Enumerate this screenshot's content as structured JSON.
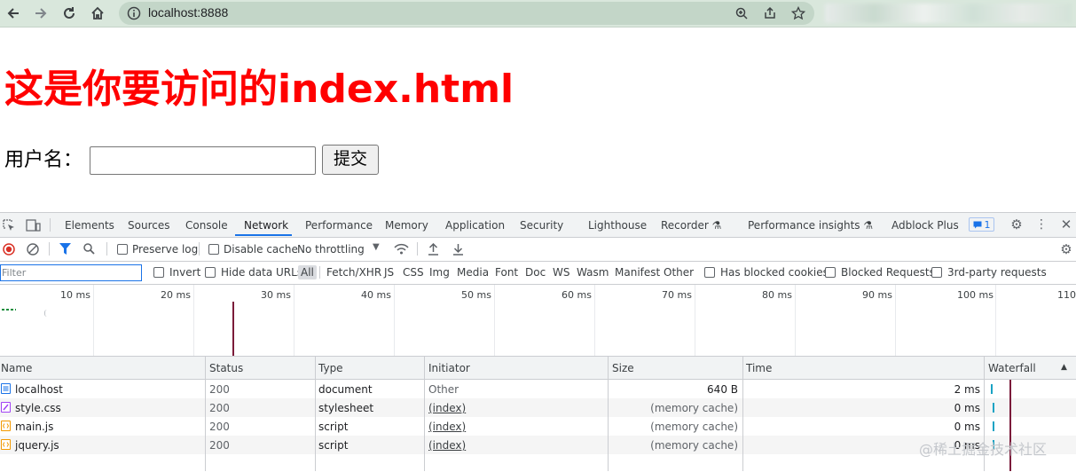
{
  "browser": {
    "url": "localhost:8888",
    "icons": [
      "back-arrow-icon",
      "forward-arrow-icon",
      "reload-icon",
      "home-icon",
      "info-icon",
      "zoom-icon",
      "share-icon",
      "star-icon"
    ]
  },
  "page": {
    "title": "这是你要访问的index.html",
    "username_label": "用户名：",
    "username_value": "",
    "submit_label": "提交"
  },
  "devtools": {
    "tabs": [
      "Elements",
      "Sources",
      "Console",
      "Network",
      "Performance",
      "Memory",
      "Application",
      "Security",
      "Lighthouse",
      "Recorder",
      "Performance insights",
      "Adblock Plus"
    ],
    "active_tab": "Network",
    "issues_count": "1",
    "toolbar": {
      "preserve_log": "Preserve log",
      "disable_cache": "Disable cache",
      "throttling": "No throttling"
    },
    "filter": {
      "placeholder": "Filter",
      "invert": "Invert",
      "hide_data_urls": "Hide data URLs",
      "types": [
        "All",
        "Fetch/XHR",
        "JS",
        "CSS",
        "Img",
        "Media",
        "Font",
        "Doc",
        "WS",
        "Wasm",
        "Manifest",
        "Other"
      ],
      "active_type": "All",
      "has_blocked_cookies": "Has blocked cookies",
      "blocked_requests": "Blocked Requests",
      "third_party": "3rd-party requests"
    },
    "overview_ticks": [
      "10 ms",
      "20 ms",
      "30 ms",
      "40 ms",
      "50 ms",
      "60 ms",
      "70 ms",
      "80 ms",
      "90 ms",
      "100 ms",
      "110"
    ],
    "columns": [
      "Name",
      "Status",
      "Type",
      "Initiator",
      "Size",
      "Time",
      "Waterfall"
    ],
    "requests": [
      {
        "name": "localhost",
        "status": "200",
        "type": "document",
        "initiator": "Other",
        "size": "640 B",
        "time": "2 ms",
        "icon": "document-icon",
        "color": "#1a73e8"
      },
      {
        "name": "style.css",
        "status": "200",
        "type": "stylesheet",
        "initiator": "(index)",
        "size": "(memory cache)",
        "time": "0 ms",
        "icon": "stylesheet-icon",
        "color": "#a142f4"
      },
      {
        "name": "main.js",
        "status": "200",
        "type": "script",
        "initiator": "(index)",
        "size": "(memory cache)",
        "time": "0 ms",
        "icon": "script-icon",
        "color": "#f29900"
      },
      {
        "name": "jquery.js",
        "status": "200",
        "type": "script",
        "initiator": "(index)",
        "size": "(memory cache)",
        "time": "0 ms",
        "icon": "script-icon",
        "color": "#f29900"
      }
    ]
  },
  "watermark": "@稀土掘金技术社区"
}
